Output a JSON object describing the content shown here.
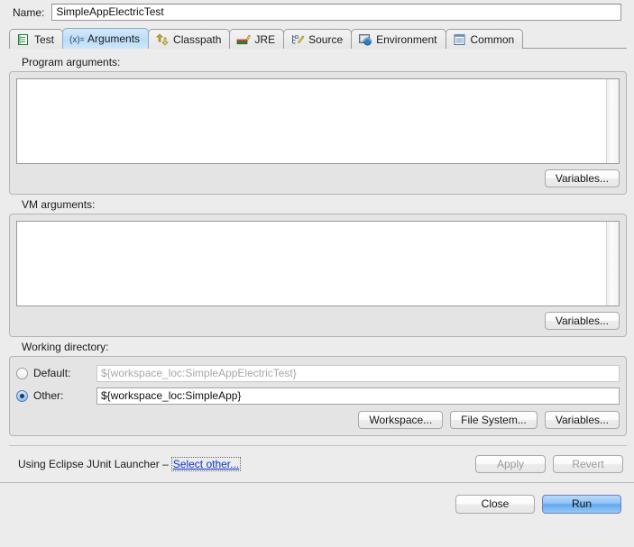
{
  "name_field": {
    "label": "Name:",
    "value": "SimpleAppElectricTest"
  },
  "tabs": [
    {
      "label": "Test",
      "icon": "test-icon",
      "active": false
    },
    {
      "label": "Arguments",
      "icon": "arguments-icon",
      "active": true
    },
    {
      "label": "Classpath",
      "icon": "classpath-icon",
      "active": false
    },
    {
      "label": "JRE",
      "icon": "jre-icon",
      "active": false
    },
    {
      "label": "Source",
      "icon": "source-icon",
      "active": false
    },
    {
      "label": "Environment",
      "icon": "environment-icon",
      "active": false
    },
    {
      "label": "Common",
      "icon": "common-icon",
      "active": false
    }
  ],
  "program_arguments": {
    "label": "Program arguments:",
    "value": "",
    "variables_button": "Variables..."
  },
  "vm_arguments": {
    "label": "VM arguments:",
    "value": "",
    "variables_button": "Variables..."
  },
  "working_directory": {
    "label": "Working directory:",
    "default_radio_label": "Default:",
    "default_value": "${workspace_loc:SimpleAppElectricTest}",
    "default_selected": false,
    "other_radio_label": "Other:",
    "other_value": "${workspace_loc:SimpleApp}",
    "other_selected": true,
    "workspace_button": "Workspace...",
    "filesystem_button": "File System...",
    "variables_button": "Variables..."
  },
  "footer": {
    "launcher_text": "Using Eclipse JUnit Launcher –",
    "launcher_link": "Select other...",
    "apply_button": "Apply",
    "revert_button": "Revert",
    "close_button": "Close",
    "run_button": "Run"
  },
  "colors": {
    "window_background": "#ececec",
    "group_background": "#e4e4e4",
    "active_tab": "#bcdcf7",
    "link": "#0b34c6",
    "default_button": "#8fc4f6",
    "muted_text": "#a7a7a7"
  }
}
